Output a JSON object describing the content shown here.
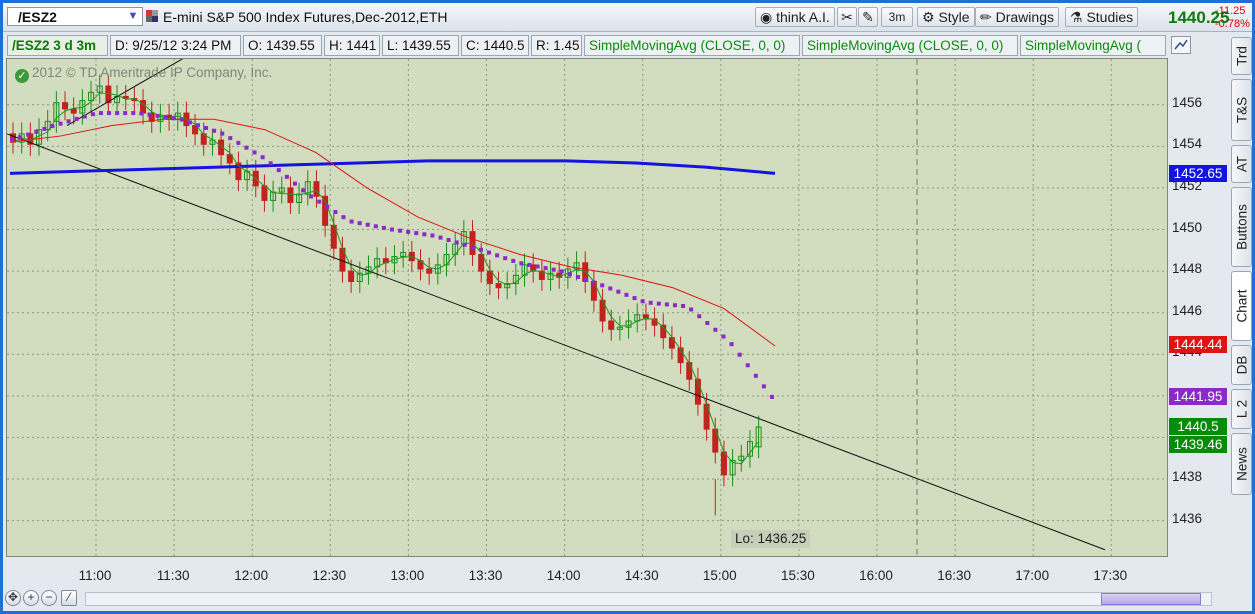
{
  "toolbar": {
    "symbol": "/ESZ2",
    "description": "E-mini S&P 500 Index Futures,Dec-2012,ETH",
    "think_ai": "think A.I.",
    "timeframe": "3m",
    "style": "Style",
    "drawings": "Drawings",
    "studies": "Studies",
    "last_price": "1440.25",
    "change": "-11.25",
    "change_pct": "-0.78%"
  },
  "infobar": {
    "symbol_period": "/ESZ2 3 d 3m",
    "date": "D: 9/25/12 3:24 PM",
    "open": "O: 1439.55",
    "high": "H: 1441",
    "low": "L: 1439.55",
    "close": "C: 1440.5",
    "range": "R: 1.45",
    "sma1": "SimpleMovingAvg (CLOSE, 0, 0)",
    "sma2": "SimpleMovingAvg (CLOSE, 0, 0)",
    "sma3": "SimpleMovingAvg ("
  },
  "watermark": "2012 © TD Ameritrade IP Company, Inc.",
  "low_label": "Lo: 1436.25",
  "price_tags": [
    {
      "text": "1452.65",
      "color": "#1414e0"
    },
    {
      "text": "1444.44",
      "color": "#e01414"
    },
    {
      "text": "1441.95",
      "color": "#8a2bc8"
    },
    {
      "text": "1440.5",
      "color": "#0a8a0a"
    },
    {
      "text": "1439.46",
      "color": "#0a8a0a"
    }
  ],
  "side_tabs": [
    "Trd",
    "T&S",
    "AT",
    "Buttons",
    "Chart",
    "DB",
    "L 2",
    "News"
  ],
  "chart_data": {
    "type": "candlestick",
    "symbol": "/ESZ2",
    "x_tick_labels": [
      "11:00",
      "11:30",
      "12:00",
      "12:30",
      "13:00",
      "13:30",
      "14:00",
      "14:30",
      "15:00",
      "15:30",
      "16:00",
      "16:30",
      "17:00",
      "17:30"
    ],
    "y_tick_labels": [
      "1456",
      "1454",
      "1452",
      "1450",
      "1448",
      "1446",
      "1444",
      "1438",
      "1436"
    ],
    "ylim": [
      1434.3,
      1458.2
    ],
    "grid": true,
    "candles_close": [
      1454.2,
      1454.6,
      1454.1,
      1454.8,
      1455.2,
      1456.1,
      1455.8,
      1455.6,
      1456.2,
      1456.6,
      1456.9,
      1456.1,
      1456.4,
      1456.3,
      1456.2,
      1455.6,
      1455.2,
      1455.5,
      1455.3,
      1455.6,
      1455.0,
      1454.6,
      1454.1,
      1454.3,
      1453.6,
      1453.2,
      1452.4,
      1452.8,
      1452.1,
      1451.4,
      1451.8,
      1452.0,
      1451.3,
      1451.7,
      1452.3,
      1451.6,
      1450.2,
      1449.1,
      1448.0,
      1447.5,
      1447.9,
      1448.2,
      1448.6,
      1448.4,
      1448.7,
      1448.9,
      1448.5,
      1448.1,
      1447.9,
      1448.3,
      1448.8,
      1449.3,
      1449.9,
      1448.8,
      1448.0,
      1447.4,
      1447.2,
      1447.4,
      1447.8,
      1448.3,
      1448.0,
      1447.6,
      1447.9,
      1447.7,
      1448.1,
      1448.4,
      1447.5,
      1446.6,
      1445.6,
      1445.2,
      1445.3,
      1445.6,
      1445.9,
      1445.7,
      1445.4,
      1444.8,
      1444.3,
      1443.6,
      1442.8,
      1441.6,
      1440.4,
      1439.3,
      1438.2,
      1438.9,
      1439.1,
      1439.8,
      1440.5
    ],
    "candles_open": [
      1454.6,
      1454.2,
      1454.6,
      1454.1,
      1454.8,
      1455.2,
      1456.1,
      1455.8,
      1455.6,
      1456.2,
      1456.6,
      1456.9,
      1456.1,
      1456.4,
      1456.3,
      1456.2,
      1455.6,
      1455.2,
      1455.5,
      1455.3,
      1455.6,
      1455.0,
      1454.6,
      1454.1,
      1454.3,
      1453.6,
      1453.2,
      1452.4,
      1452.8,
      1452.1,
      1451.4,
      1451.8,
      1452.0,
      1451.3,
      1451.7,
      1452.3,
      1451.6,
      1450.2,
      1449.1,
      1448.0,
      1447.5,
      1447.9,
      1448.2,
      1448.6,
      1448.4,
      1448.7,
      1448.9,
      1448.5,
      1448.1,
      1447.9,
      1448.3,
      1448.8,
      1449.3,
      1449.9,
      1448.8,
      1448.0,
      1447.4,
      1447.2,
      1447.4,
      1447.8,
      1448.3,
      1448.0,
      1447.6,
      1447.9,
      1447.7,
      1448.1,
      1448.4,
      1447.5,
      1446.6,
      1445.6,
      1445.2,
      1445.3,
      1445.6,
      1445.9,
      1445.7,
      1445.4,
      1444.8,
      1444.3,
      1443.6,
      1442.8,
      1441.6,
      1440.4,
      1439.3,
      1438.2,
      1438.9,
      1439.1,
      1439.55
    ],
    "series": [
      {
        "type": "sma-blue",
        "values": [
          1452.7,
          1452.8,
          1452.9,
          1453.0,
          1453.1,
          1453.2,
          1453.3,
          1453.3,
          1453.3,
          1453.2,
          1453.0,
          1452.7
        ]
      },
      {
        "type": "sma-red",
        "values": [
          1454.2,
          1454.5,
          1455.0,
          1455.3,
          1455.3,
          1454.8,
          1453.7,
          1452.0,
          1450.6,
          1449.6,
          1448.8,
          1448.2,
          1447.8,
          1447.2,
          1446.2,
          1444.4
        ]
      },
      {
        "type": "sma-purple-dots",
        "values": [
          1454.3,
          1455.0,
          1455.6,
          1455.6,
          1455.3,
          1454.6,
          1453.4,
          1451.7,
          1450.4,
          1450.0,
          1449.7,
          1449.1,
          1448.4,
          1448.0,
          1447.3,
          1446.5,
          1446.3,
          1444.6,
          1441.95
        ]
      }
    ],
    "low_annotation": "Lo: 1436.25"
  }
}
